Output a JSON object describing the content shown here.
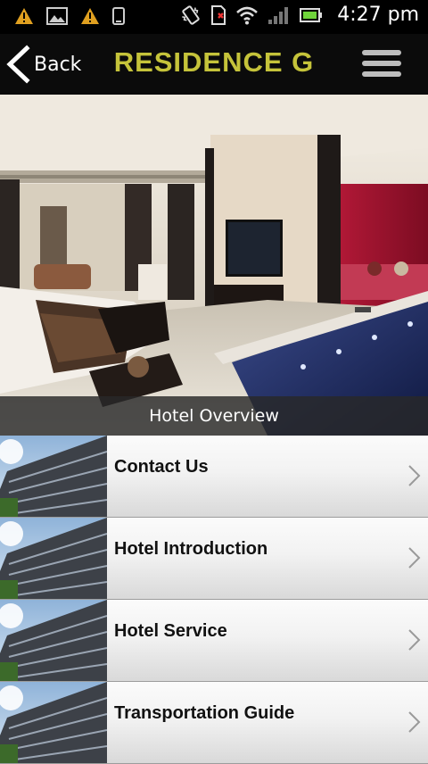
{
  "status_bar": {
    "time": "4:27 pm",
    "left_icons": [
      "warning-icon",
      "image-icon",
      "warning-icon",
      "phone-icon"
    ],
    "right_icons": [
      "vibrate-icon",
      "no-sim-icon",
      "wifi-icon",
      "signal-icon",
      "battery-icon"
    ]
  },
  "header": {
    "back_label": "Back",
    "title": "RESIDENCE G",
    "title_color": "#c5c33a",
    "menu_icon": "hamburger-menu-icon"
  },
  "hero": {
    "caption": "Hotel Overview"
  },
  "menu_items": [
    {
      "label": "Contact Us"
    },
    {
      "label": "Hotel Introduction"
    },
    {
      "label": "Hotel Service"
    },
    {
      "label": "Transportation Guide"
    }
  ]
}
